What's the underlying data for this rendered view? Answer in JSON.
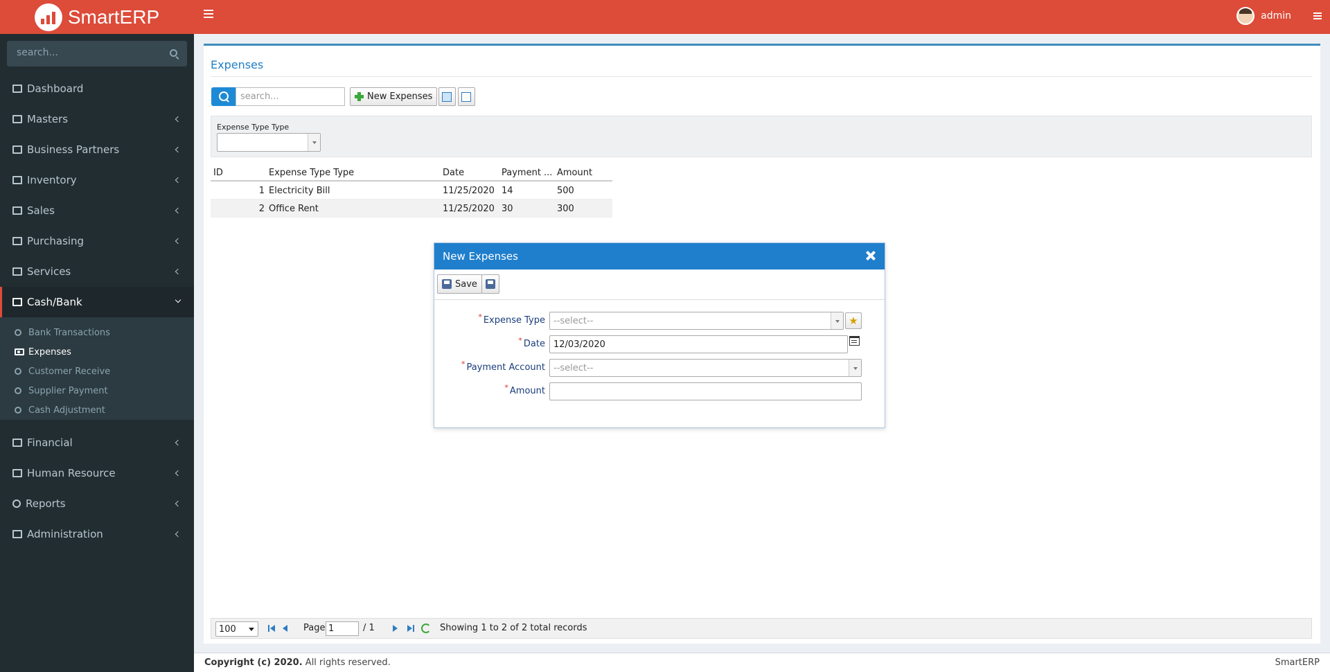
{
  "app": {
    "name": "SmartERP",
    "user": "admin"
  },
  "sidebar": {
    "search_placeholder": "search...",
    "items": [
      {
        "label": "Dashboard",
        "icon": "dashboard-icon"
      },
      {
        "label": "Masters",
        "icon": "list-icon"
      },
      {
        "label": "Business Partners",
        "icon": "id-card-icon"
      },
      {
        "label": "Inventory",
        "icon": "grid-icon"
      },
      {
        "label": "Sales",
        "icon": "cart-icon"
      },
      {
        "label": "Purchasing",
        "icon": "file-icon"
      },
      {
        "label": "Services",
        "icon": "gears-icon"
      },
      {
        "label": "Cash/Bank",
        "icon": "bank-icon"
      },
      {
        "label": "Financial",
        "icon": "briefcase-icon"
      },
      {
        "label": "Human Resource",
        "icon": "users-icon"
      },
      {
        "label": "Reports",
        "icon": "circle-icon"
      },
      {
        "label": "Administration",
        "icon": "desktop-icon"
      }
    ],
    "submenu": [
      {
        "label": "Bank Transactions"
      },
      {
        "label": "Expenses"
      },
      {
        "label": "Customer Receive"
      },
      {
        "label": "Supplier Payment"
      },
      {
        "label": "Cash Adjustment"
      }
    ]
  },
  "page": {
    "title": "Expenses",
    "search_placeholder": "search...",
    "new_button": "New Expenses",
    "filter_label": "Expense Type Type",
    "filter_value": ""
  },
  "grid": {
    "columns": [
      "ID",
      "Expense Type Type",
      "Date",
      "Payment ...",
      "Amount"
    ],
    "rows": [
      {
        "id": "1",
        "type": "Electricity Bill",
        "date": "11/25/2020",
        "payment": "14",
        "amount": "500"
      },
      {
        "id": "2",
        "type": "Office Rent",
        "date": "11/25/2020",
        "payment": "30",
        "amount": "300"
      }
    ]
  },
  "pager": {
    "page_size": "100",
    "page_label": "Page",
    "page": "1",
    "total_pages": "/ 1",
    "summary": "Showing 1 to 2 of 2 total records"
  },
  "modal": {
    "title": "New Expenses",
    "save_label": "Save",
    "fields": {
      "expense_type": {
        "label": "Expense Type",
        "value": "--select--"
      },
      "date": {
        "label": "Date",
        "value": "12/03/2020"
      },
      "payment_account": {
        "label": "Payment Account",
        "value": "--select--"
      },
      "amount": {
        "label": "Amount",
        "value": ""
      }
    },
    "required_mark": "*"
  },
  "footer": {
    "copyright": "Copyright (c) 2020.",
    "rights": "All rights reserved.",
    "brand": "SmartERP"
  },
  "colors": {
    "header": "#dd4b39",
    "sidebar": "#222d32",
    "accent": "#1f7fcc"
  }
}
